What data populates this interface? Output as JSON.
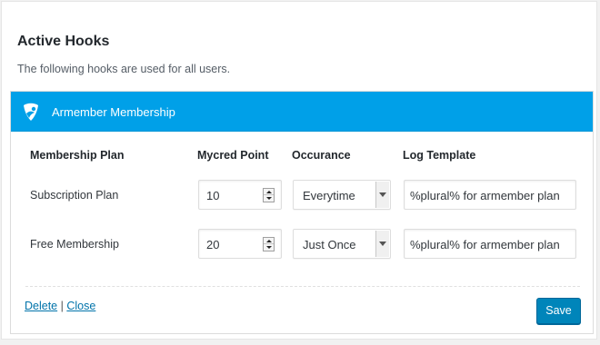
{
  "page": {
    "title": "Active Hooks",
    "subtitle": "The following hooks are used for all users."
  },
  "hook": {
    "title": "Armember Membership",
    "header_color": "#00a0e8",
    "logo_icon": "armember-logo-icon"
  },
  "table": {
    "columns": [
      "Membership Plan",
      "Mycred Point",
      "Occurance",
      "Log Template"
    ],
    "rows": [
      {
        "plan": "Subscription Plan",
        "points": "10",
        "occurance": "Everytime",
        "log_template": "%plural% for armember plan"
      },
      {
        "plan": "Free Membership",
        "points": "20",
        "occurance": "Just Once",
        "log_template": "%plural% for armember plan"
      }
    ]
  },
  "footer": {
    "delete_label": "Delete",
    "separator": "|",
    "close_label": "Close",
    "save_label": "Save",
    "save_color": "#0085ba"
  }
}
